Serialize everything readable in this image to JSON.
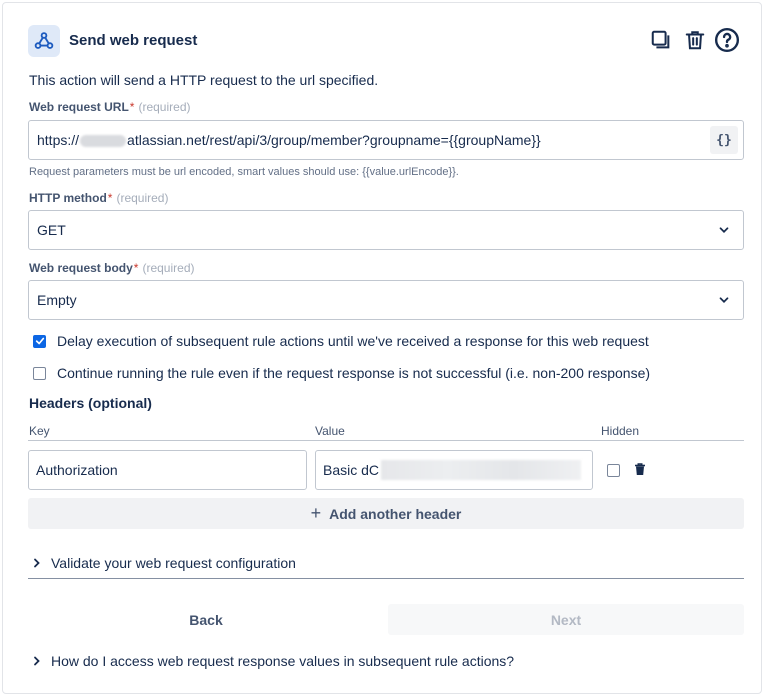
{
  "header": {
    "title": "Send web request",
    "icon": "webhook-icon",
    "actions": [
      {
        "name": "duplicate-icon"
      },
      {
        "name": "trash-icon"
      },
      {
        "name": "help-icon"
      }
    ]
  },
  "description": "This action will send a HTTP request to the url specified.",
  "url_field": {
    "label": "Web request URL",
    "required_mark": "*",
    "required_text": "(required)",
    "value_prefix": "https://",
    "value_suffix": "atlassian.net/rest/api/3/group/member?groupname={{groupName}}",
    "smart_button": "{}",
    "help": "Request parameters must be url encoded, smart values should use: {{value.urlEncode}}."
  },
  "method_field": {
    "label": "HTTP method",
    "required_mark": "*",
    "required_text": "(required)",
    "value": "GET"
  },
  "body_field": {
    "label": "Web request body",
    "required_mark": "*",
    "required_text": "(required)",
    "value": "Empty"
  },
  "options": {
    "delay": {
      "label": "Delay execution of subsequent rule actions until we've received a response for this web request",
      "checked": true
    },
    "continue": {
      "label": "Continue running the rule even if the request response is not successful (i.e. non-200 response)",
      "checked": false
    }
  },
  "headers": {
    "title": "Headers (optional)",
    "columns": {
      "key": "Key",
      "value": "Value",
      "hidden": "Hidden"
    },
    "rows": [
      {
        "key": "Authorization",
        "value_prefix": "Basic dC",
        "hidden": false
      }
    ],
    "add_label": "Add another header"
  },
  "validate_label": "Validate your web request configuration",
  "footer": {
    "back": "Back",
    "next": "Next",
    "faq": "How do I access web request response values in subsequent rule actions?"
  },
  "colors": {
    "primary": "#0c66e4",
    "text": "#172b4d",
    "subtle": "#44546f",
    "danger": "#c9372c"
  }
}
